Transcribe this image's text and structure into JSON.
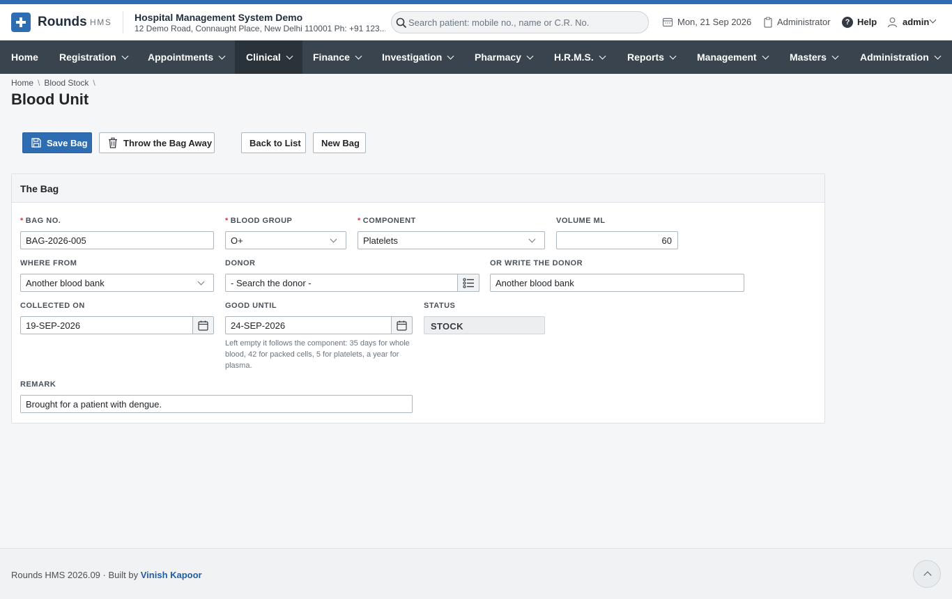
{
  "app": {
    "brand": "Rounds",
    "brand_sub": "HMS",
    "org_name": "Hospital Management System Demo",
    "org_address": "12 Demo Road, Connaught Place, New Delhi 110001 Ph: +91 123..."
  },
  "header": {
    "search_placeholder": "Search patient: mobile no., name or C.R. No.",
    "date": "Mon, 21 Sep 2026",
    "role": "Administrator",
    "help": "Help",
    "user": "admin"
  },
  "nav": {
    "items": [
      {
        "label": "Home"
      },
      {
        "label": "Registration"
      },
      {
        "label": "Appointments"
      },
      {
        "label": "Clinical"
      },
      {
        "label": "Finance"
      },
      {
        "label": "Investigation"
      },
      {
        "label": "Pharmacy"
      },
      {
        "label": "H.R.M.S."
      },
      {
        "label": "Reports"
      },
      {
        "label": "Management"
      },
      {
        "label": "Masters"
      },
      {
        "label": "Administration"
      }
    ],
    "active": "Clinical"
  },
  "breadcrumb": {
    "items": [
      "Home",
      "Blood Stock"
    ]
  },
  "page": {
    "title": "Blood Unit"
  },
  "toolbar": {
    "save": "Save Bag",
    "throw": "Throw the Bag Away",
    "back": "Back to List",
    "new": "New Bag"
  },
  "card": {
    "title": "The Bag"
  },
  "form": {
    "bag_no": {
      "label": "BAG NO.",
      "value": "BAG-2026-005",
      "required": true
    },
    "blood_group": {
      "label": "BLOOD GROUP",
      "value": "O+",
      "required": true
    },
    "component": {
      "label": "COMPONENT",
      "value": "Platelets",
      "required": true
    },
    "volume": {
      "label": "VOLUME ML",
      "value": "60"
    },
    "where_from": {
      "label": "WHERE FROM",
      "value": "Another blood bank"
    },
    "donor": {
      "label": "DONOR",
      "value": "- Search the donor -"
    },
    "write_donor": {
      "label": "OR WRITE THE DONOR",
      "value": "Another blood bank"
    },
    "collected_on": {
      "label": "COLLECTED ON",
      "value": "19-SEP-2026"
    },
    "good_until": {
      "label": "GOOD UNTIL",
      "value": "24-SEP-2026",
      "help": "Left empty it follows the component: 35 days for whole blood, 42 for packed cells, 5 for platelets, a year for plasma."
    },
    "status": {
      "label": "STATUS",
      "value": "STOCK"
    },
    "remark": {
      "label": "REMARK",
      "value": "Brought for a patient with dengue."
    }
  },
  "footer": {
    "text": "Rounds HMS 2026.09 · Built by",
    "author": "Vinish Kapoor"
  },
  "colors": {
    "accent": "#2f6db3",
    "nav_bg": "#3a444e",
    "nav_active": "#2a323a",
    "required": "#d9363e"
  }
}
